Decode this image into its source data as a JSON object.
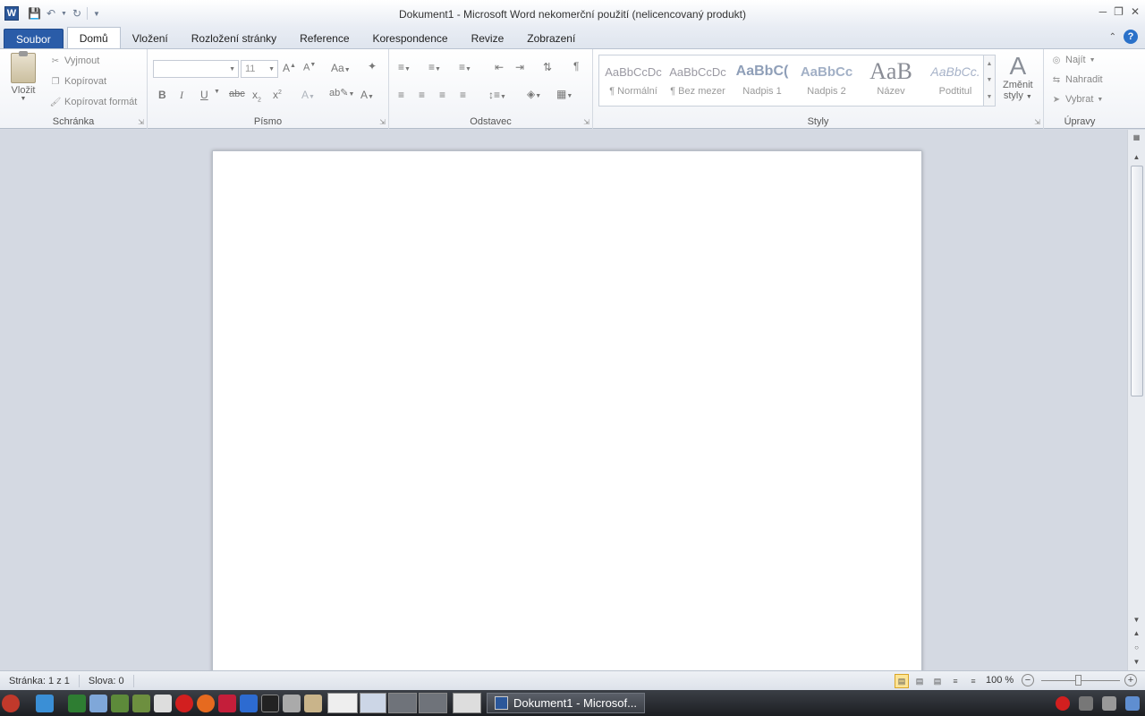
{
  "window": {
    "title": "Dokument1  -  Microsoft Word nekomerční použití (nelicencovaný produkt)",
    "app_icon_letter": "W"
  },
  "tabs": [
    "Soubor",
    "Domů",
    "Vložení",
    "Rozložení stránky",
    "Reference",
    "Korespondence",
    "Revize",
    "Zobrazení"
  ],
  "ribbon": {
    "clipboard": {
      "label": "Schránka",
      "paste": "Vložit",
      "cut": "Vyjmout",
      "copy": "Kopírovat",
      "format_painter": "Kopírovat formát"
    },
    "font": {
      "label": "Písmo",
      "font_name": "",
      "font_size": "11"
    },
    "paragraph": {
      "label": "Odstavec"
    },
    "styles": {
      "label": "Styly",
      "items": [
        {
          "sample": "AaBbCcDc",
          "name": "¶ Normální"
        },
        {
          "sample": "AaBbCcDc",
          "name": "¶ Bez mezer"
        },
        {
          "sample": "AaBbC(",
          "name": "Nadpis 1"
        },
        {
          "sample": "AaBbCc",
          "name": "Nadpis 2"
        },
        {
          "sample": "AaB",
          "name": "Název"
        },
        {
          "sample": "AaBbCc.",
          "name": "Podtitul"
        }
      ],
      "change_styles_line1": "Změnit",
      "change_styles_line2": "styly"
    },
    "editing": {
      "label": "Úpravy",
      "find": "Najít",
      "replace": "Nahradit",
      "select": "Vybrat"
    }
  },
  "status": {
    "page": "Stránka: 1 z 1",
    "words": "Slova: 0",
    "zoom": "100 %"
  },
  "taskbar": {
    "active_window": "Dokument1 - Microsof..."
  },
  "colors": {
    "file_tab": "#2a5ca8",
    "word_blue": "#2b579a"
  }
}
